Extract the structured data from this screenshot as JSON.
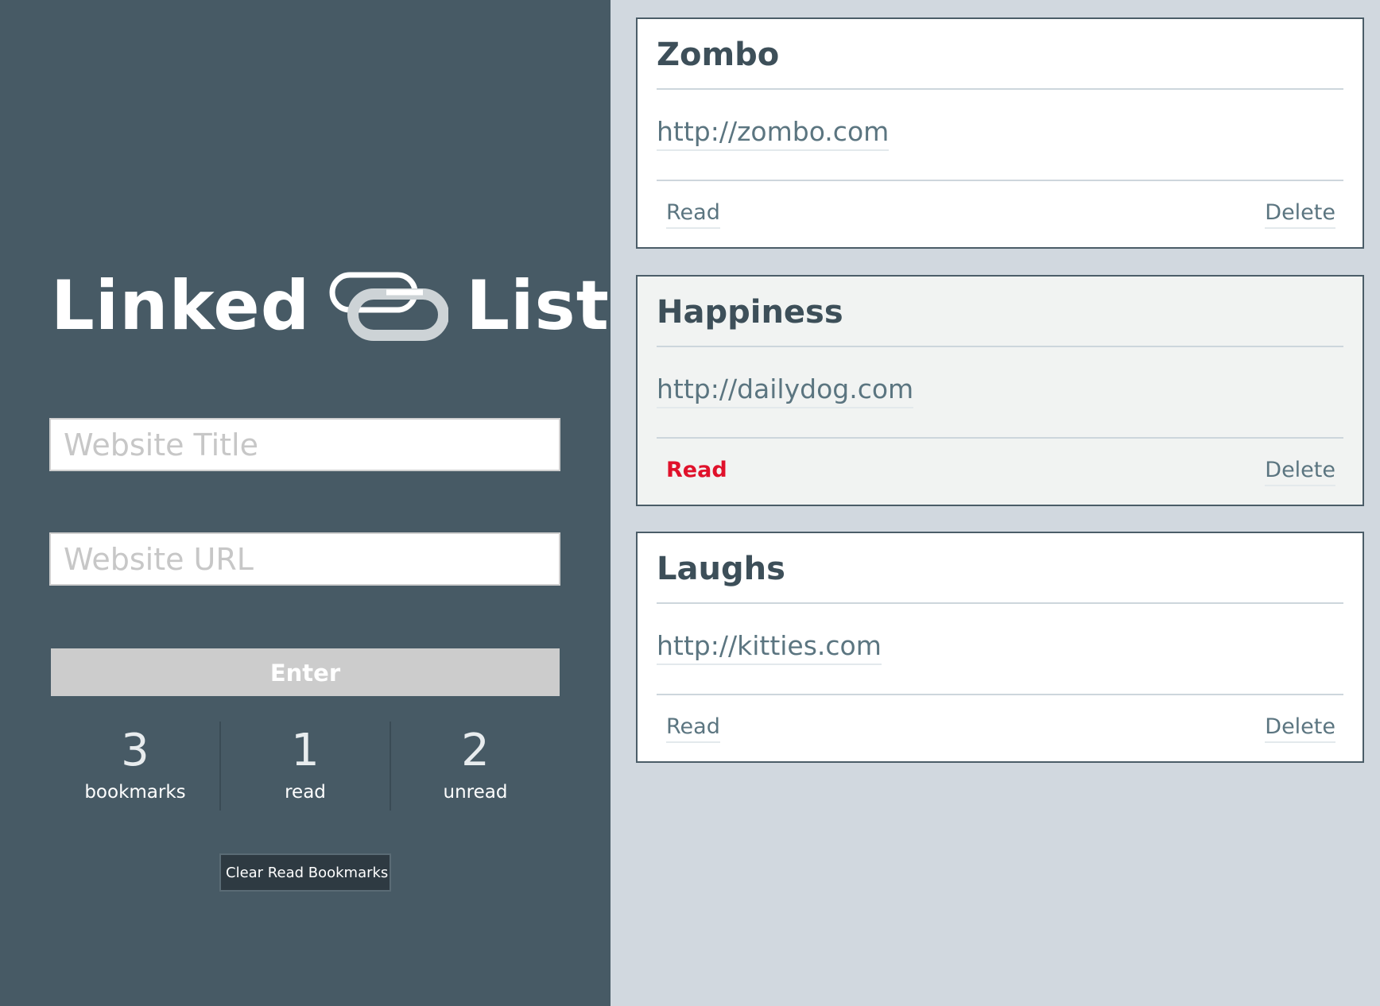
{
  "logo": {
    "word_left": "Linked",
    "word_right": "List",
    "icon": "chain-link-icon"
  },
  "form": {
    "title_placeholder": "Website Title",
    "url_placeholder": "Website URL",
    "enter_label": "Enter"
  },
  "stats": [
    {
      "value": "3",
      "label": "bookmarks"
    },
    {
      "value": "1",
      "label": "read"
    },
    {
      "value": "2",
      "label": "unread"
    }
  ],
  "clear_label": "Clear Read Bookmarks",
  "bookmarks": [
    {
      "title": "Zombo",
      "url": "http://zombo.com",
      "read_label": "Read",
      "delete_label": "Delete",
      "is_read": false
    },
    {
      "title": "Happiness",
      "url": "http://dailydog.com",
      "read_label": "Read",
      "delete_label": "Delete",
      "is_read": true
    },
    {
      "title": "Laughs",
      "url": "http://kitties.com",
      "read_label": "Read",
      "delete_label": "Delete",
      "is_read": false
    }
  ],
  "colors": {
    "panel": "#475a65",
    "background": "#d1d8df",
    "read_active": "#e0112b",
    "link": "#5b7580"
  }
}
